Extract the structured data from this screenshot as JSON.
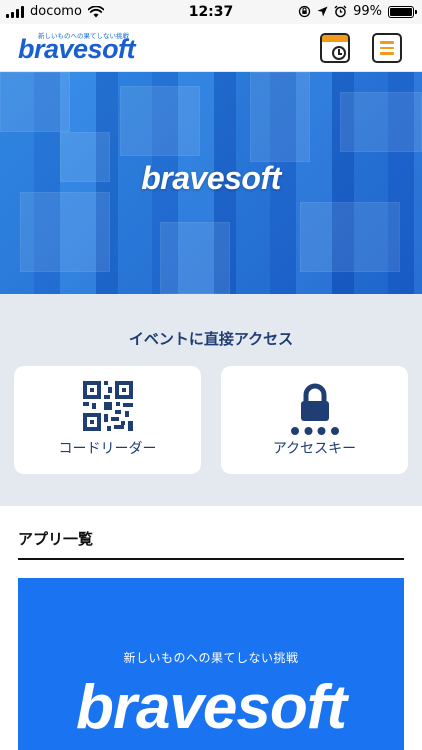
{
  "status_bar": {
    "carrier": "docomo",
    "time": "12:37",
    "battery_percent": "99%",
    "battery_level": 0.99
  },
  "nav": {
    "logo_tagline": "新しいものへの果てしない挑戦",
    "logo_text": "bravesoft",
    "calendar_icon": "calendar-clock-icon",
    "menu_icon": "hamburger-menu-icon",
    "accent_color": "#f29a1a"
  },
  "hero": {
    "logo_text": "bravesoft",
    "background_color": "#2f72d0"
  },
  "event_access": {
    "title": "イベントに直接アクセス",
    "cards": [
      {
        "label": "コードリーダー",
        "icon": "qr-code-icon"
      },
      {
        "label": "アクセスキー",
        "icon": "lock-keypad-icon"
      }
    ],
    "text_color": "#1f3e73",
    "background_color": "#e4e8ef"
  },
  "apps": {
    "title": "アプリ一覧",
    "banner": {
      "tagline": "新しいものへの果てしない挑戦",
      "logo_text": "bravesoft",
      "background_color": "#1a73f0"
    }
  }
}
